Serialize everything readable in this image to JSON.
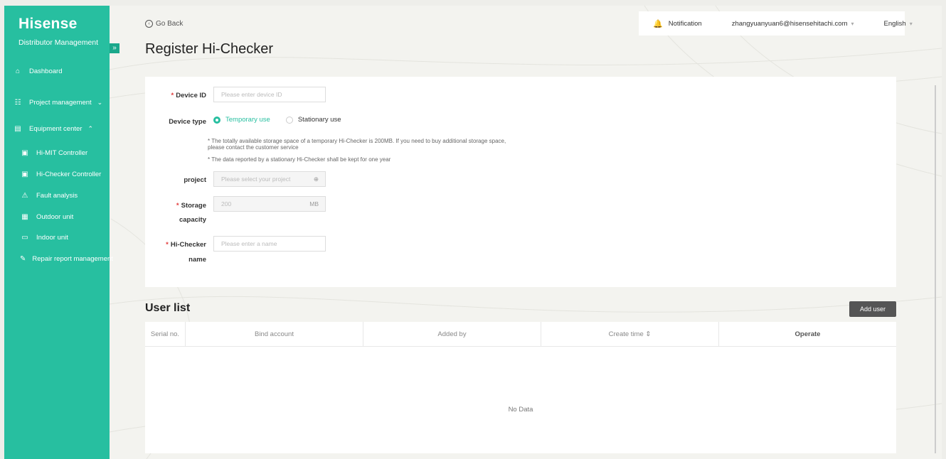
{
  "sidebar": {
    "brand": "Hisense",
    "subtitle": "Distributor Management",
    "collapse": "»",
    "items": [
      {
        "label": "Dashboard",
        "icon": "⌂"
      },
      {
        "label": "Project management",
        "icon": "☷"
      },
      {
        "label": "Equipment center",
        "icon": "▤"
      },
      {
        "label": "Hi-MIT Controller",
        "icon": "▣"
      },
      {
        "label": "Hi-Checker Controller",
        "icon": "▣"
      },
      {
        "label": "Fault analysis",
        "icon": "⚠"
      },
      {
        "label": "Outdoor unit",
        "icon": "▦"
      },
      {
        "label": "Indoor unit",
        "icon": "▭"
      },
      {
        "label": "Repair report management",
        "icon": "✎"
      }
    ],
    "chev_down": "⌄",
    "chev_up": "⌃"
  },
  "header": {
    "go_back": "Go Back",
    "go_back_icon": "‹",
    "title": "Register Hi-Checker",
    "notification": "Notification",
    "email": "zhangyuanyuan6@hisensehitachi.com",
    "language": "English",
    "caret": "▾",
    "bell": "🔔"
  },
  "form": {
    "required_mark": "*",
    "device_id_label": "Device ID",
    "device_id_placeholder": "Please enter device ID",
    "device_type_label": "Device type",
    "type_temporary": "Temporary use",
    "type_stationary": "Stationary use",
    "hint1": "* The totally available storage space of a temporary Hi-Checker is 200MB. If you need to buy additional storage space, please contact the customer service",
    "hint2": "* The data reported by a stationary Hi-Checker shall be kept for one year",
    "project_label": "project",
    "project_placeholder": "Please select your project",
    "project_icon": "⊕",
    "storage_label_1": "Storage",
    "storage_label_2": "capacity",
    "storage_value": "200",
    "storage_unit": "MB",
    "name_label_1": "Hi-Checker",
    "name_label_2": "name",
    "name_placeholder": "Please enter a name"
  },
  "user_list": {
    "title": "User list",
    "add_button": "Add user",
    "columns": [
      "Serial no.",
      "Bind account",
      "Added by",
      "Create time ⇕",
      "Operate"
    ],
    "empty": "No Data"
  },
  "colors": {
    "accent": "#27bfa0",
    "required": "#e23b3b"
  }
}
